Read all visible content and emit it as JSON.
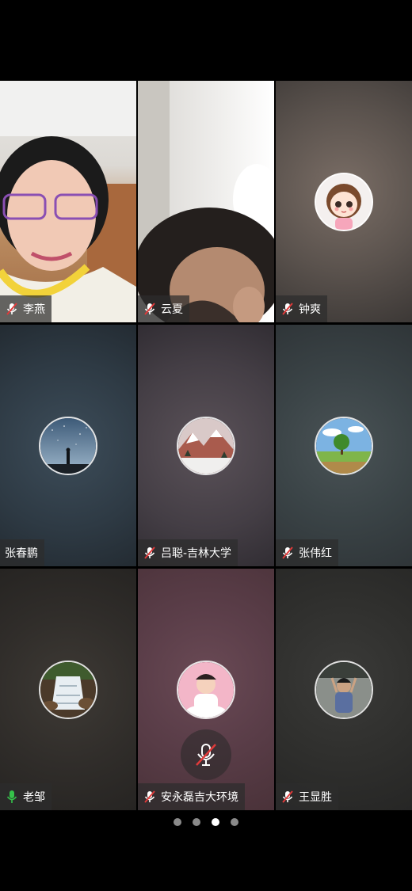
{
  "participants": [
    {
      "name": "李燕",
      "mic": "muted",
      "kind": "video-woman-glasses"
    },
    {
      "name": "云夏",
      "mic": "muted",
      "kind": "video-woman"
    },
    {
      "name": "钟爽",
      "mic": "muted",
      "kind": "avatar-cartoon-girl"
    },
    {
      "name": "张春鹏",
      "mic": "none",
      "kind": "avatar-starry-sky"
    },
    {
      "name": "吕聪-吉林大学",
      "mic": "muted",
      "kind": "avatar-snowy-mountain"
    },
    {
      "name": "张伟红",
      "mic": "muted",
      "kind": "avatar-tree-field"
    },
    {
      "name": "老邹",
      "mic": "active",
      "kind": "avatar-waterfall"
    },
    {
      "name": "安永磊吉大环境",
      "mic": "muted",
      "kind": "avatar-baby"
    },
    {
      "name": "王显胜",
      "mic": "muted",
      "kind": "avatar-child"
    }
  ],
  "pager": {
    "count": 4,
    "active_index": 2
  },
  "colors": {
    "mic_active": "#35c24a",
    "muted_slash": "#e03a3a",
    "label_bg": "#2d2d2d"
  }
}
